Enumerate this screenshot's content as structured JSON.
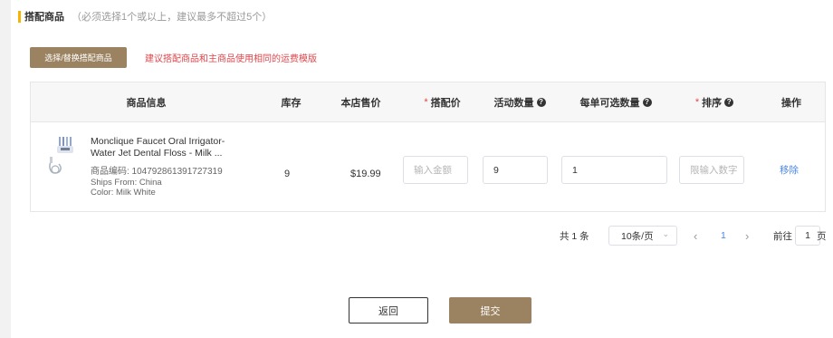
{
  "section": {
    "title": "搭配商品",
    "hint": "（必须选择1个或以上，建议最多不超过5个）"
  },
  "toolbar": {
    "select_button": "选择/替换搭配商品",
    "warning": "建议搭配商品和主商品使用相同的运费模版"
  },
  "table": {
    "headers": {
      "product_info": "商品信息",
      "stock": "库存",
      "store_price": "本店售价",
      "bundle_price": "搭配价",
      "activity_qty": "活动数量",
      "per_order_qty": "每单可选数量",
      "sort": "排序",
      "action": "操作"
    },
    "row": {
      "name_line1": "Monclique Faucet Oral Irrigator-",
      "name_line2": "Water Jet Dental Floss - Milk ...",
      "code": "商品编码: 104792861391727319",
      "ships_from": "Ships From: China",
      "color": "Color: Milk White",
      "stock": "9",
      "store_price": "$19.99",
      "bundle_price_placeholder": "输入金额",
      "activity_qty": "9",
      "per_order_qty": "1",
      "sort_placeholder": "限输入数字",
      "remove": "移除"
    }
  },
  "pagination": {
    "total": "共 1 条",
    "page_size": "10条/页",
    "prev": "‹",
    "current_page": "1",
    "next": "›",
    "goto_label": "前往",
    "goto_value": "1",
    "page_unit": "页"
  },
  "footer": {
    "back_label": "返回",
    "submit_label": "提交"
  },
  "colors": {
    "accent": "#9b8361",
    "warning": "#e0454b",
    "link": "#4a86e8",
    "marker": "#f5b400"
  },
  "icons": {
    "help": "question-circle-icon",
    "chevron": "chevron-down-icon"
  }
}
